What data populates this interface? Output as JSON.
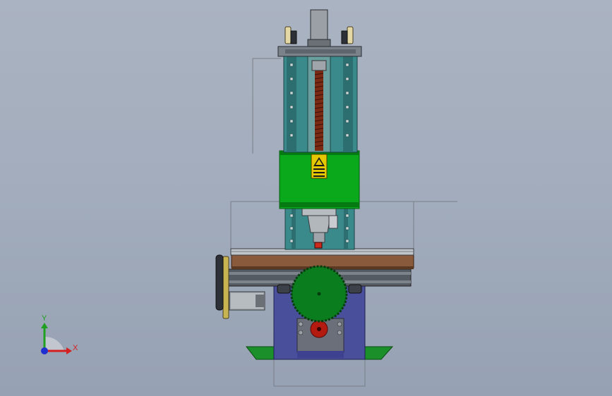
{
  "viewport": {
    "background": "#a3adbd"
  },
  "model": {
    "colors": {
      "column_teal": "#3a8a8c",
      "column_dark": "#2d6f70",
      "carriage_green": "#0aa81b",
      "carriage_dark": "#067a12",
      "table_brown": "#8a5a3c",
      "base_blue": "#4a4f9c",
      "base_dark": "#34387a",
      "gear_green": "#0a7d1e",
      "gear_red": "#b31a10",
      "leadscrew": "#7a2a12",
      "plate_gray": "#7c8289",
      "foot_green": "#1a8f2a",
      "warning_yellow": "#e6c800"
    }
  },
  "triad": {
    "x_label": "X",
    "y_label": "Y",
    "x_color": "#d42020",
    "y_color": "#20a020",
    "z_color": "#2030d0"
  }
}
